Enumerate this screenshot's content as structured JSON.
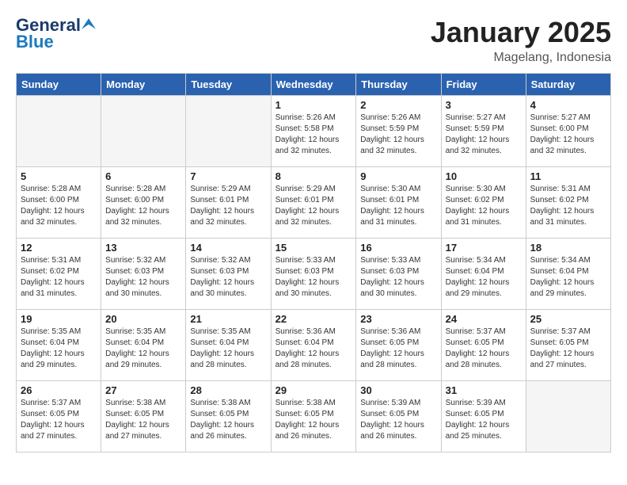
{
  "header": {
    "logo_line1": "General",
    "logo_line2": "Blue",
    "title": "January 2025",
    "subtitle": "Magelang, Indonesia"
  },
  "days_of_week": [
    "Sunday",
    "Monday",
    "Tuesday",
    "Wednesday",
    "Thursday",
    "Friday",
    "Saturday"
  ],
  "weeks": [
    [
      {
        "day": "",
        "info": ""
      },
      {
        "day": "",
        "info": ""
      },
      {
        "day": "",
        "info": ""
      },
      {
        "day": "1",
        "info": "Sunrise: 5:26 AM\nSunset: 5:58 PM\nDaylight: 12 hours\nand 32 minutes."
      },
      {
        "day": "2",
        "info": "Sunrise: 5:26 AM\nSunset: 5:59 PM\nDaylight: 12 hours\nand 32 minutes."
      },
      {
        "day": "3",
        "info": "Sunrise: 5:27 AM\nSunset: 5:59 PM\nDaylight: 12 hours\nand 32 minutes."
      },
      {
        "day": "4",
        "info": "Sunrise: 5:27 AM\nSunset: 6:00 PM\nDaylight: 12 hours\nand 32 minutes."
      }
    ],
    [
      {
        "day": "5",
        "info": "Sunrise: 5:28 AM\nSunset: 6:00 PM\nDaylight: 12 hours\nand 32 minutes."
      },
      {
        "day": "6",
        "info": "Sunrise: 5:28 AM\nSunset: 6:00 PM\nDaylight: 12 hours\nand 32 minutes."
      },
      {
        "day": "7",
        "info": "Sunrise: 5:29 AM\nSunset: 6:01 PM\nDaylight: 12 hours\nand 32 minutes."
      },
      {
        "day": "8",
        "info": "Sunrise: 5:29 AM\nSunset: 6:01 PM\nDaylight: 12 hours\nand 32 minutes."
      },
      {
        "day": "9",
        "info": "Sunrise: 5:30 AM\nSunset: 6:01 PM\nDaylight: 12 hours\nand 31 minutes."
      },
      {
        "day": "10",
        "info": "Sunrise: 5:30 AM\nSunset: 6:02 PM\nDaylight: 12 hours\nand 31 minutes."
      },
      {
        "day": "11",
        "info": "Sunrise: 5:31 AM\nSunset: 6:02 PM\nDaylight: 12 hours\nand 31 minutes."
      }
    ],
    [
      {
        "day": "12",
        "info": "Sunrise: 5:31 AM\nSunset: 6:02 PM\nDaylight: 12 hours\nand 31 minutes."
      },
      {
        "day": "13",
        "info": "Sunrise: 5:32 AM\nSunset: 6:03 PM\nDaylight: 12 hours\nand 30 minutes."
      },
      {
        "day": "14",
        "info": "Sunrise: 5:32 AM\nSunset: 6:03 PM\nDaylight: 12 hours\nand 30 minutes."
      },
      {
        "day": "15",
        "info": "Sunrise: 5:33 AM\nSunset: 6:03 PM\nDaylight: 12 hours\nand 30 minutes."
      },
      {
        "day": "16",
        "info": "Sunrise: 5:33 AM\nSunset: 6:03 PM\nDaylight: 12 hours\nand 30 minutes."
      },
      {
        "day": "17",
        "info": "Sunrise: 5:34 AM\nSunset: 6:04 PM\nDaylight: 12 hours\nand 29 minutes."
      },
      {
        "day": "18",
        "info": "Sunrise: 5:34 AM\nSunset: 6:04 PM\nDaylight: 12 hours\nand 29 minutes."
      }
    ],
    [
      {
        "day": "19",
        "info": "Sunrise: 5:35 AM\nSunset: 6:04 PM\nDaylight: 12 hours\nand 29 minutes."
      },
      {
        "day": "20",
        "info": "Sunrise: 5:35 AM\nSunset: 6:04 PM\nDaylight: 12 hours\nand 29 minutes."
      },
      {
        "day": "21",
        "info": "Sunrise: 5:35 AM\nSunset: 6:04 PM\nDaylight: 12 hours\nand 28 minutes."
      },
      {
        "day": "22",
        "info": "Sunrise: 5:36 AM\nSunset: 6:04 PM\nDaylight: 12 hours\nand 28 minutes."
      },
      {
        "day": "23",
        "info": "Sunrise: 5:36 AM\nSunset: 6:05 PM\nDaylight: 12 hours\nand 28 minutes."
      },
      {
        "day": "24",
        "info": "Sunrise: 5:37 AM\nSunset: 6:05 PM\nDaylight: 12 hours\nand 28 minutes."
      },
      {
        "day": "25",
        "info": "Sunrise: 5:37 AM\nSunset: 6:05 PM\nDaylight: 12 hours\nand 27 minutes."
      }
    ],
    [
      {
        "day": "26",
        "info": "Sunrise: 5:37 AM\nSunset: 6:05 PM\nDaylight: 12 hours\nand 27 minutes."
      },
      {
        "day": "27",
        "info": "Sunrise: 5:38 AM\nSunset: 6:05 PM\nDaylight: 12 hours\nand 27 minutes."
      },
      {
        "day": "28",
        "info": "Sunrise: 5:38 AM\nSunset: 6:05 PM\nDaylight: 12 hours\nand 26 minutes."
      },
      {
        "day": "29",
        "info": "Sunrise: 5:38 AM\nSunset: 6:05 PM\nDaylight: 12 hours\nand 26 minutes."
      },
      {
        "day": "30",
        "info": "Sunrise: 5:39 AM\nSunset: 6:05 PM\nDaylight: 12 hours\nand 26 minutes."
      },
      {
        "day": "31",
        "info": "Sunrise: 5:39 AM\nSunset: 6:05 PM\nDaylight: 12 hours\nand 25 minutes."
      },
      {
        "day": "",
        "info": ""
      }
    ]
  ]
}
